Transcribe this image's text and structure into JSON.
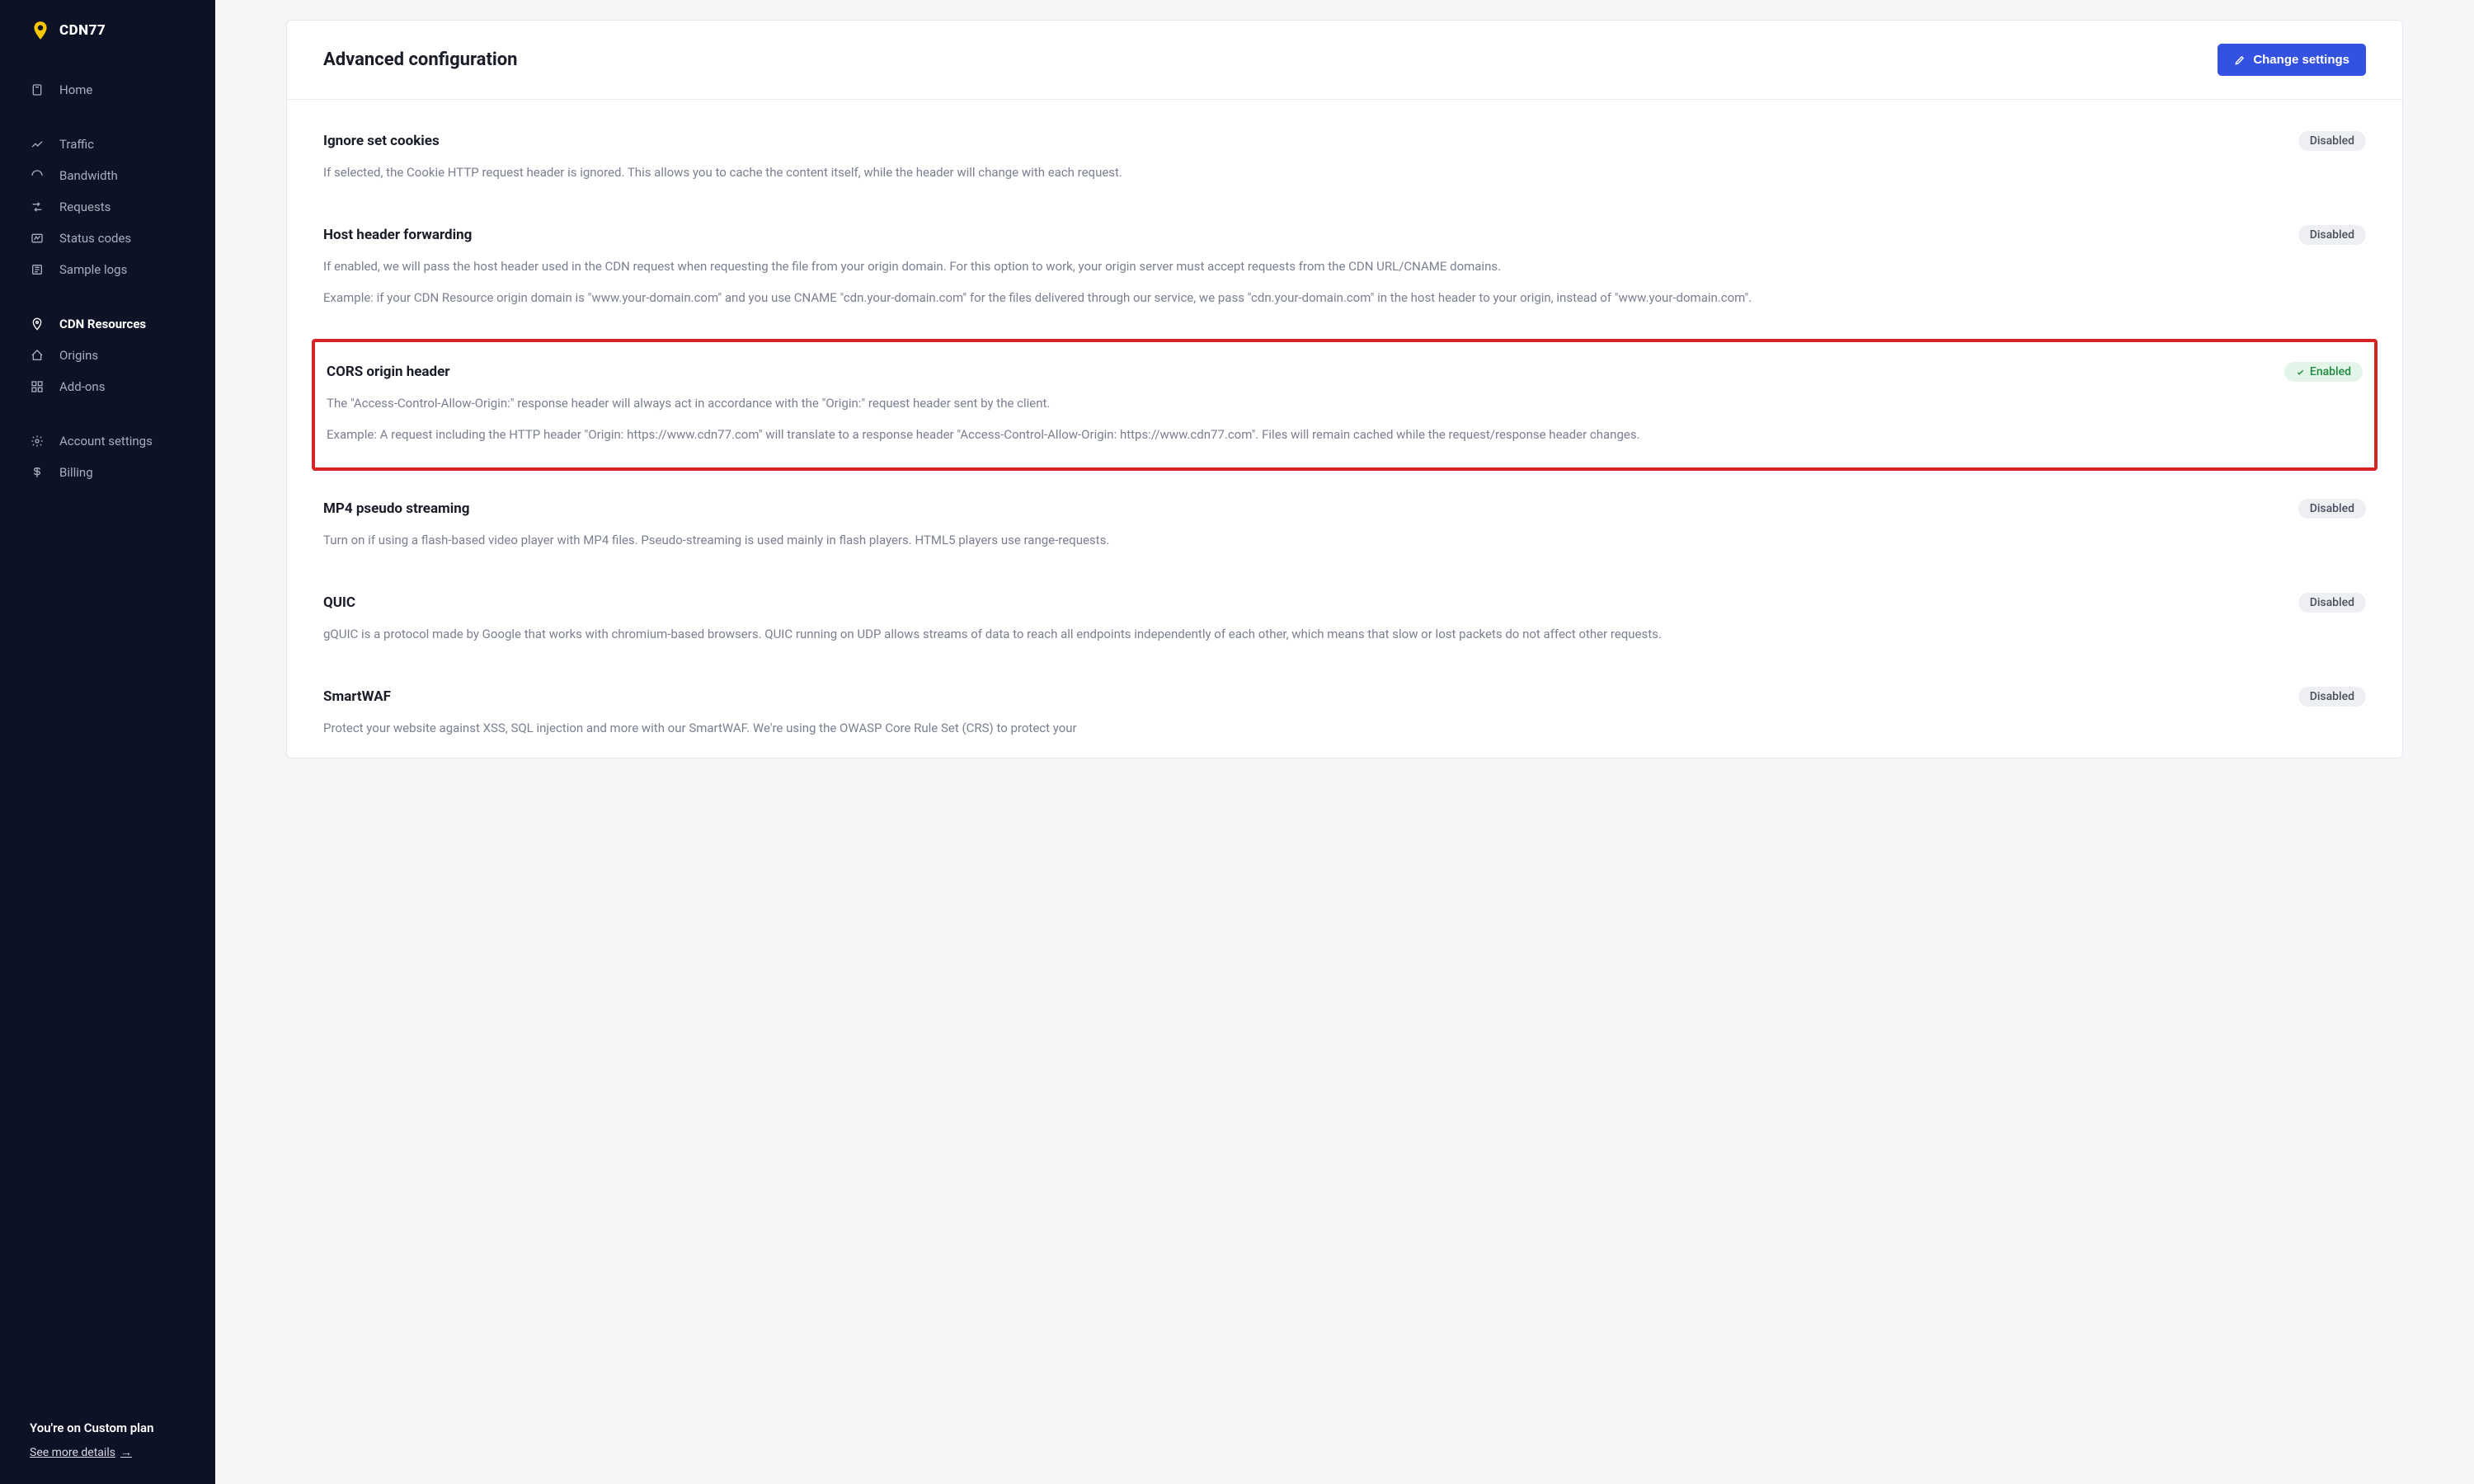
{
  "brand": {
    "name": "CDN77"
  },
  "sidebar": {
    "items": [
      {
        "label": "Home",
        "icon": "home"
      },
      {
        "label": "Traffic",
        "icon": "traffic"
      },
      {
        "label": "Bandwidth",
        "icon": "bandwidth"
      },
      {
        "label": "Requests",
        "icon": "requests"
      },
      {
        "label": "Status codes",
        "icon": "status"
      },
      {
        "label": "Sample logs",
        "icon": "logs"
      },
      {
        "label": "CDN Resources",
        "icon": "pin",
        "active": true
      },
      {
        "label": "Origins",
        "icon": "origins"
      },
      {
        "label": "Add-ons",
        "icon": "addons"
      },
      {
        "label": "Account settings",
        "icon": "settings"
      },
      {
        "label": "Billing",
        "icon": "billing"
      }
    ],
    "plan_text": "You're on Custom plan",
    "details_link": "See more details"
  },
  "page": {
    "title": "Advanced configuration",
    "change_button": "Change settings"
  },
  "settings": [
    {
      "title": "Ignore set cookies",
      "status": "Disabled",
      "paragraphs": [
        "If selected, the Cookie HTTP request header is ignored. This allows you to cache the content itself, while the header will change with each request."
      ]
    },
    {
      "title": "Host header forwarding",
      "status": "Disabled",
      "paragraphs": [
        "If enabled, we will pass the host header used in the CDN request when requesting the file from your origin domain. For this option to work, your origin server must accept requests from the CDN URL/CNAME domains.",
        "Example: if your CDN Resource origin domain is \"www.your-domain.com\" and you use CNAME \"cdn.your-domain.com\" for the files delivered through our service, we pass \"cdn.your-domain.com\" in the host header to your origin, instead of \"www.your-domain.com\"."
      ]
    },
    {
      "title": "CORS origin header",
      "status": "Enabled",
      "highlighted": true,
      "paragraphs": [
        "The \"Access-Control-Allow-Origin:\" response header will always act in accordance with the \"Origin:\" request header sent by the client.",
        "Example: A request including the HTTP header \"Origin: https://www.cdn77.com\" will translate to a response header \"Access-Control-Allow-Origin: https://www.cdn77.com\". Files will remain cached while the request/response header changes."
      ]
    },
    {
      "title": "MP4 pseudo streaming",
      "status": "Disabled",
      "paragraphs": [
        "Turn on if using a flash-based video player with MP4 files. Pseudo-streaming is used mainly in flash players. HTML5 players use range-requests."
      ]
    },
    {
      "title": "QUIC",
      "status": "Disabled",
      "paragraphs": [
        "gQUIC is a protocol made by Google that works with chromium-based browsers. QUIC running on UDP allows streams of data to reach all endpoints independently of each other, which means that slow or lost packets do not affect other requests."
      ]
    },
    {
      "title": "SmartWAF",
      "status": "Disabled",
      "paragraphs": [
        "Protect your website against XSS, SQL injection and more with our SmartWAF. We're using the OWASP Core Rule Set (CRS) to protect your"
      ]
    }
  ]
}
